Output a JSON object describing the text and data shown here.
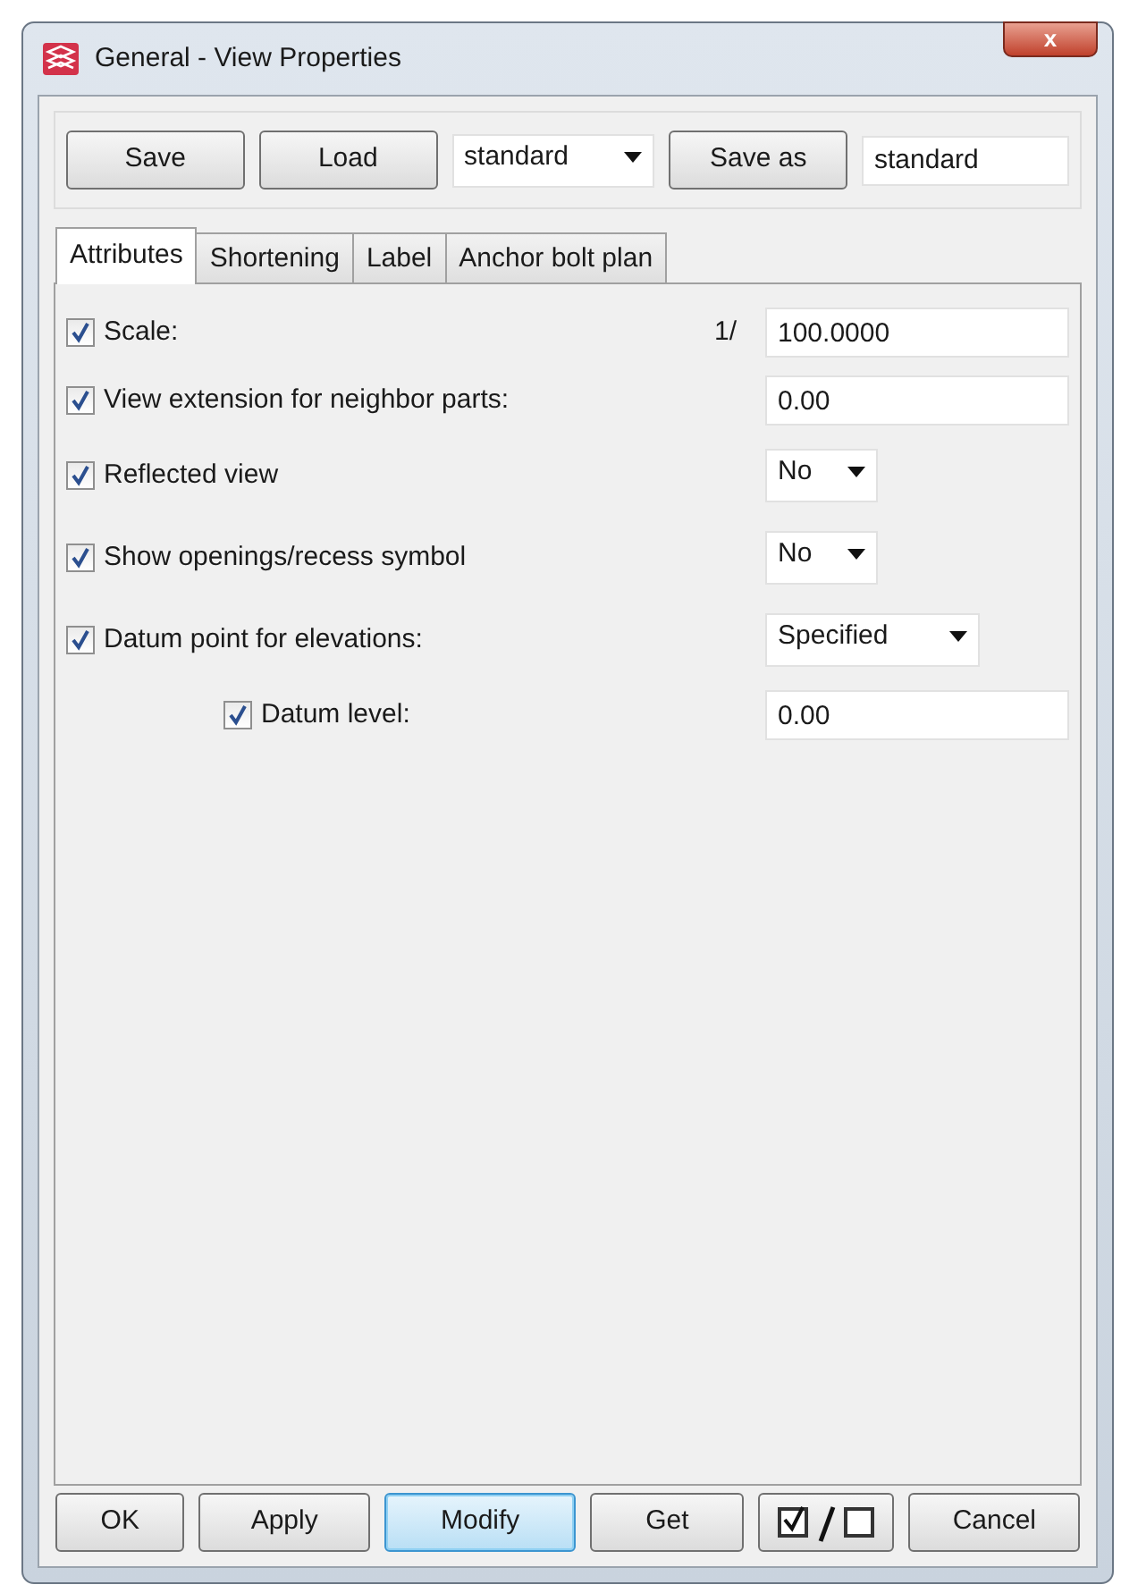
{
  "window": {
    "title": "General - View Properties",
    "close": "x"
  },
  "toolbar": {
    "buttons": [
      "Save",
      "Load"
    ],
    "preset_select": "standard",
    "save_as_button": "Save as",
    "save_as_field": "standard"
  },
  "tabs": [
    {
      "label": "Attributes",
      "selected": true
    },
    {
      "label": "Shortening",
      "selected": false
    },
    {
      "label": "Label",
      "selected": false
    },
    {
      "label": "Anchor bolt plan",
      "selected": false
    }
  ],
  "rows": [
    {
      "label": "Scale:",
      "checked": true,
      "prefix": "1/",
      "kind": "text",
      "value": "100.0000"
    },
    {
      "label": "View extension for neighbor parts:",
      "checked": true,
      "kind": "text",
      "value": "0.00"
    },
    {
      "label": "Reflected view",
      "checked": true,
      "kind": "select",
      "value": "No"
    },
    {
      "label": "Show openings/recess symbol",
      "checked": true,
      "kind": "select",
      "value": "No"
    },
    {
      "label": "Datum point for elevations:",
      "checked": true,
      "kind": "select",
      "value": "Specified",
      "children": [
        {
          "label": "Datum level:",
          "checked": true,
          "kind": "text",
          "value": "0.00"
        }
      ]
    }
  ],
  "footer": [
    {
      "kind": "button",
      "label": "OK",
      "default": false
    },
    {
      "kind": "button",
      "label": "Apply",
      "default": false
    },
    {
      "kind": "button",
      "label": "Modify",
      "default": true
    },
    {
      "kind": "button",
      "label": "Get",
      "default": false
    },
    {
      "kind": "toggle"
    },
    {
      "kind": "button",
      "label": "Cancel",
      "default": false
    }
  ]
}
